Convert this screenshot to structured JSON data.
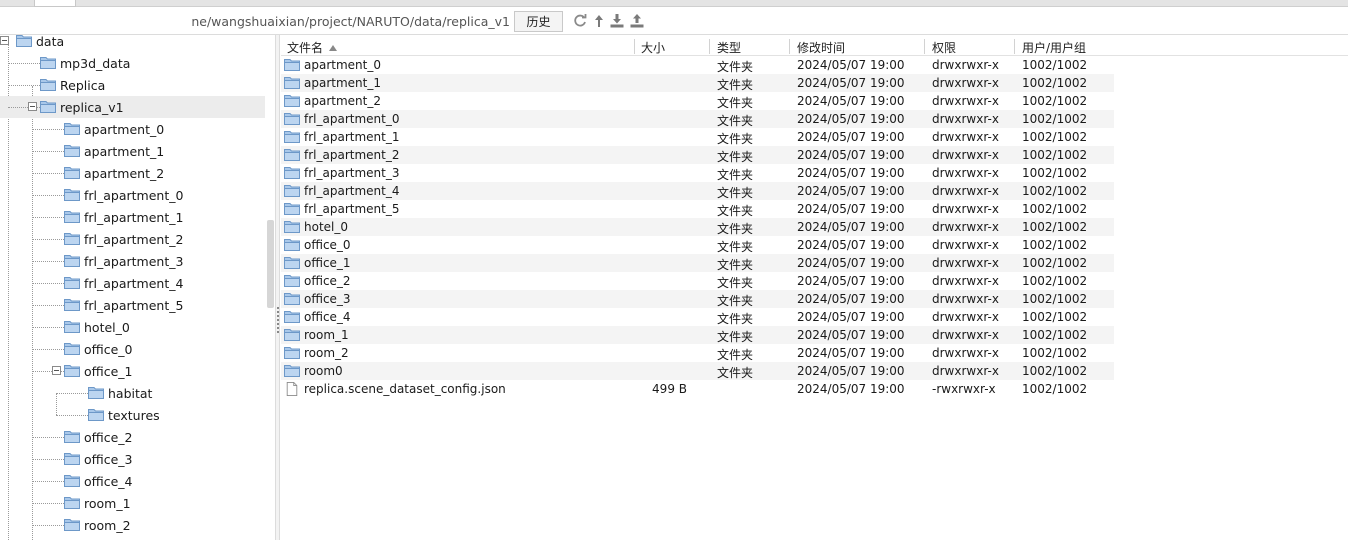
{
  "path_bar": {
    "path": "ne/wangshuaixian/project/NARUTO/data/replica_v1",
    "history_label": "历史"
  },
  "toolbar_icons": [
    "refresh-icon",
    "up-directory-icon",
    "download-icon",
    "upload-icon"
  ],
  "tree": {
    "items": [
      {
        "label": "data",
        "level": 0,
        "expanded": true
      },
      {
        "label": "mp3d_data",
        "level": 1
      },
      {
        "label": "Replica",
        "level": 1
      },
      {
        "label": "replica_v1",
        "level": 1,
        "expanded": true,
        "selected": true
      },
      {
        "label": "apartment_0",
        "level": 2
      },
      {
        "label": "apartment_1",
        "level": 2
      },
      {
        "label": "apartment_2",
        "level": 2
      },
      {
        "label": "frl_apartment_0",
        "level": 2
      },
      {
        "label": "frl_apartment_1",
        "level": 2
      },
      {
        "label": "frl_apartment_2",
        "level": 2
      },
      {
        "label": "frl_apartment_3",
        "level": 2
      },
      {
        "label": "frl_apartment_4",
        "level": 2
      },
      {
        "label": "frl_apartment_5",
        "level": 2
      },
      {
        "label": "hotel_0",
        "level": 2
      },
      {
        "label": "office_0",
        "level": 2
      },
      {
        "label": "office_1",
        "level": 2,
        "expanded": true
      },
      {
        "label": "habitat",
        "level": 3
      },
      {
        "label": "textures",
        "level": 3
      },
      {
        "label": "office_2",
        "level": 2
      },
      {
        "label": "office_3",
        "level": 2
      },
      {
        "label": "office_4",
        "level": 2
      },
      {
        "label": "room_1",
        "level": 2
      },
      {
        "label": "room_2",
        "level": 2
      }
    ]
  },
  "file_list": {
    "columns": {
      "name": "文件名",
      "size": "大小",
      "type": "类型",
      "modified": "修改时间",
      "permissions": "权限",
      "owner": "用户/用户组"
    },
    "rows": [
      {
        "name": "apartment_0",
        "size": "",
        "type": "文件夹",
        "modified": "2024/05/07 19:00",
        "permissions": "drwxrwxr-x",
        "owner": "1002/1002",
        "kind": "folder"
      },
      {
        "name": "apartment_1",
        "size": "",
        "type": "文件夹",
        "modified": "2024/05/07 19:00",
        "permissions": "drwxrwxr-x",
        "owner": "1002/1002",
        "kind": "folder"
      },
      {
        "name": "apartment_2",
        "size": "",
        "type": "文件夹",
        "modified": "2024/05/07 19:00",
        "permissions": "drwxrwxr-x",
        "owner": "1002/1002",
        "kind": "folder"
      },
      {
        "name": "frl_apartment_0",
        "size": "",
        "type": "文件夹",
        "modified": "2024/05/07 19:00",
        "permissions": "drwxrwxr-x",
        "owner": "1002/1002",
        "kind": "folder"
      },
      {
        "name": "frl_apartment_1",
        "size": "",
        "type": "文件夹",
        "modified": "2024/05/07 19:00",
        "permissions": "drwxrwxr-x",
        "owner": "1002/1002",
        "kind": "folder"
      },
      {
        "name": "frl_apartment_2",
        "size": "",
        "type": "文件夹",
        "modified": "2024/05/07 19:00",
        "permissions": "drwxrwxr-x",
        "owner": "1002/1002",
        "kind": "folder"
      },
      {
        "name": "frl_apartment_3",
        "size": "",
        "type": "文件夹",
        "modified": "2024/05/07 19:00",
        "permissions": "drwxrwxr-x",
        "owner": "1002/1002",
        "kind": "folder"
      },
      {
        "name": "frl_apartment_4",
        "size": "",
        "type": "文件夹",
        "modified": "2024/05/07 19:00",
        "permissions": "drwxrwxr-x",
        "owner": "1002/1002",
        "kind": "folder"
      },
      {
        "name": "frl_apartment_5",
        "size": "",
        "type": "文件夹",
        "modified": "2024/05/07 19:00",
        "permissions": "drwxrwxr-x",
        "owner": "1002/1002",
        "kind": "folder"
      },
      {
        "name": "hotel_0",
        "size": "",
        "type": "文件夹",
        "modified": "2024/05/07 19:00",
        "permissions": "drwxrwxr-x",
        "owner": "1002/1002",
        "kind": "folder"
      },
      {
        "name": "office_0",
        "size": "",
        "type": "文件夹",
        "modified": "2024/05/07 19:00",
        "permissions": "drwxrwxr-x",
        "owner": "1002/1002",
        "kind": "folder"
      },
      {
        "name": "office_1",
        "size": "",
        "type": "文件夹",
        "modified": "2024/05/07 19:00",
        "permissions": "drwxrwxr-x",
        "owner": "1002/1002",
        "kind": "folder"
      },
      {
        "name": "office_2",
        "size": "",
        "type": "文件夹",
        "modified": "2024/05/07 19:00",
        "permissions": "drwxrwxr-x",
        "owner": "1002/1002",
        "kind": "folder"
      },
      {
        "name": "office_3",
        "size": "",
        "type": "文件夹",
        "modified": "2024/05/07 19:00",
        "permissions": "drwxrwxr-x",
        "owner": "1002/1002",
        "kind": "folder"
      },
      {
        "name": "office_4",
        "size": "",
        "type": "文件夹",
        "modified": "2024/05/07 19:00",
        "permissions": "drwxrwxr-x",
        "owner": "1002/1002",
        "kind": "folder"
      },
      {
        "name": "room_1",
        "size": "",
        "type": "文件夹",
        "modified": "2024/05/07 19:00",
        "permissions": "drwxrwxr-x",
        "owner": "1002/1002",
        "kind": "folder"
      },
      {
        "name": "room_2",
        "size": "",
        "type": "文件夹",
        "modified": "2024/05/07 19:00",
        "permissions": "drwxrwxr-x",
        "owner": "1002/1002",
        "kind": "folder"
      },
      {
        "name": "room0",
        "size": "",
        "type": "文件夹",
        "modified": "2024/05/07 19:00",
        "permissions": "drwxrwxr-x",
        "owner": "1002/1002",
        "kind": "folder"
      },
      {
        "name": "replica.scene_dataset_config.json",
        "size": "499 B",
        "type": "",
        "modified": "2024/05/07 19:00",
        "permissions": "-rwxrwxr-x",
        "owner": "1002/1002",
        "kind": "file"
      }
    ]
  },
  "colors": {
    "folder": "#a9c8ea",
    "folder_stroke": "#6d98c8",
    "row_alt": "#f4f4f4",
    "selected_tree_row": "#ececec"
  }
}
